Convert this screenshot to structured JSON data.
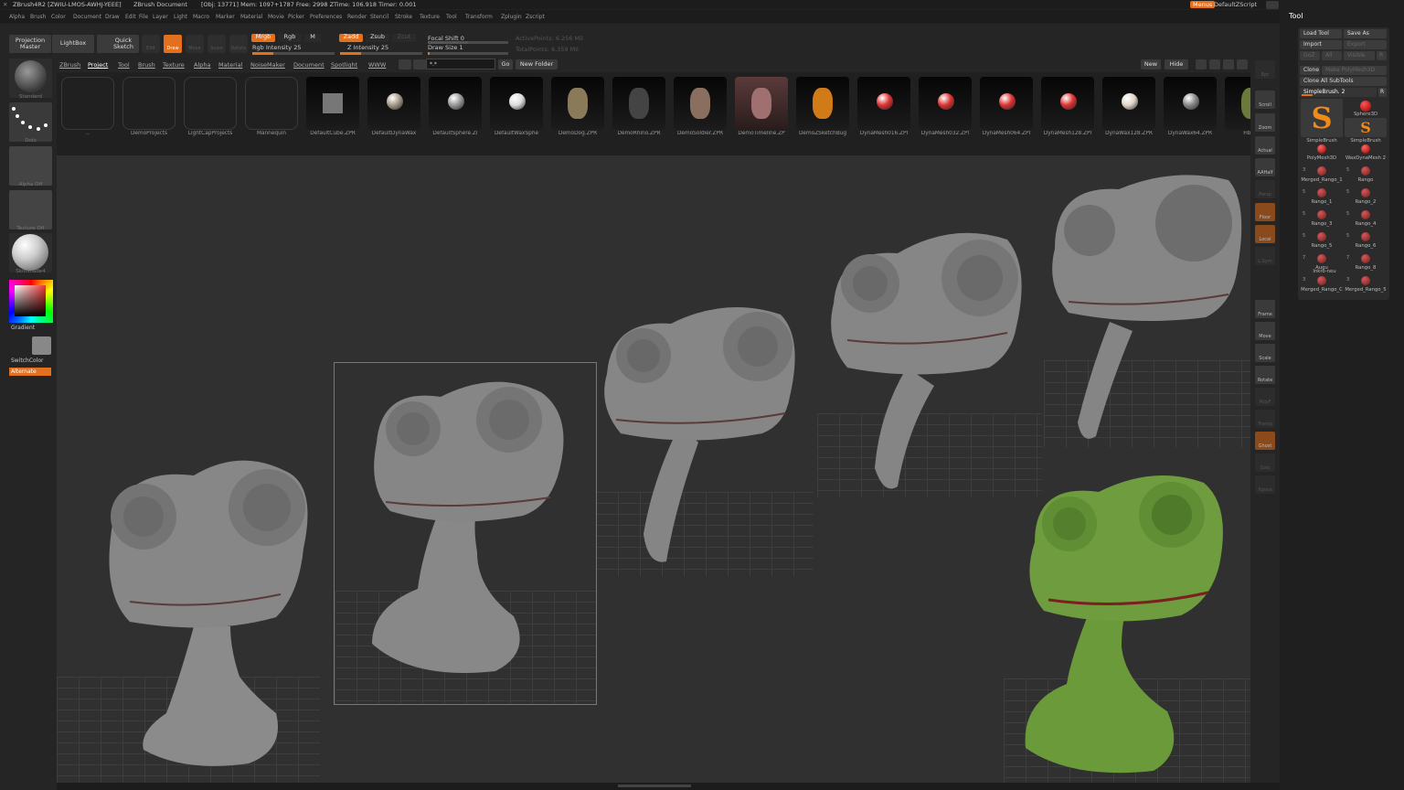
{
  "app": {
    "title": "ZBrush4R2 [ZWIU-LMOS-AWHJ-YEEE]",
    "document": "ZBrush Document",
    "stats": "[Obj: 13771] Mem: 1097+1787 Free: 2998 ZTime: 106.918 Timer: 0.001",
    "menus_btn": "Menus",
    "script_name": "DefaultZScript"
  },
  "menubar": [
    "Alpha",
    "Brush",
    "Color",
    "Document",
    "Draw",
    "Edit",
    "File",
    "Layer",
    "Light",
    "Macro",
    "Marker",
    "Material",
    "Movie",
    "Picker",
    "Preferences",
    "Render",
    "Stencil",
    "Stroke",
    "Texture",
    "Tool",
    "Transform",
    "Zplugin",
    "Zscript"
  ],
  "shelf": {
    "projection_master": "Projection Master",
    "lightbox": "LightBox",
    "quick_sketch": "Quick Sketch",
    "edit": "Edit",
    "draw": "Draw",
    "move": "Move",
    "scale": "Scale",
    "rotate": "Rotate",
    "mrgb": "Mrgb",
    "rgb": "Rgb",
    "m": "M",
    "zadd": "Zadd",
    "zsub": "Zsub",
    "zcut": "Zcut",
    "rgb_intensity": "Rgb Intensity 25",
    "z_intensity": "Z Intensity 25",
    "focal_shift": "Focal Shift 0",
    "draw_size": "Draw Size 1",
    "active_points": "ActivePoints: 6.256 Mil",
    "total_points": "TotalPoints: 6.359 Mil",
    "rgb_intensity_value": 25,
    "z_intensity_value": 25,
    "focal_shift_value": 0,
    "draw_size_value": 1
  },
  "lightbox": {
    "tabs": [
      "ZBrush",
      "Project",
      "Tool",
      "Brush",
      "Texture",
      "Alpha",
      "Material",
      "NoiseMaker",
      "Document",
      "Spotlight",
      "WWW"
    ],
    "active_tab": "Project",
    "path": "*.*",
    "go": "Go",
    "new_folder": "New Folder",
    "new": "New",
    "hide": "Hide",
    "items": [
      "..",
      "DemoProjects",
      "LightCapProjects",
      "Mannequin",
      "DefaultCube.ZPR",
      "DefaultDynaWax",
      "DefaultSphere.ZI",
      "DefaultWaxSphe",
      "DemoDog.ZPR",
      "DemoRhino.ZPR",
      "DemoSoldier.ZPR",
      "DemoTimeline.ZP",
      "DemoZSketchBug",
      "DynaMesh016.ZPI",
      "DynaMesh032.ZPI",
      "DynaMesh064.ZPI",
      "DynaMesh128.ZPI",
      "DynaWax128.ZPR",
      "DynaWax64.ZPR",
      "Fiberv"
    ]
  },
  "leftpanel": {
    "standard": "Standard",
    "dots": "Dots",
    "alpha_off": "Alpha Off",
    "texture_off": "Texture Off",
    "material": "SkinShade4",
    "gradient": "Gradient",
    "switch_color": "SwitchColor",
    "alternate": "Alternate"
  },
  "righttools": [
    "Bpr",
    "Scroll",
    "Zoom",
    "Actual",
    "AAHalf",
    "Persp",
    "Floor",
    "Local",
    "L.Sym",
    "Frame",
    "Move",
    "Scale",
    "Rotate",
    "PolyF",
    "Transp",
    "Ghost",
    "Solo",
    "Xpose"
  ],
  "tool": {
    "title": "Tool",
    "load_tool": "Load Tool",
    "save_as": "Save As",
    "import": "Import",
    "export": "Export",
    "goz": "GoZ",
    "all": "All",
    "visible": "Visible",
    "r": "R",
    "clone": "Clone",
    "make_polymesh": "Make PolyMesh3D",
    "clone_all": "Clone All SubTools",
    "current": "SimpleBrush. 2",
    "current_r": "R",
    "items": [
      {
        "name": "SimpleBrush",
        "num": ""
      },
      {
        "name": "Sphere3D",
        "num": ""
      },
      {
        "name": "",
        "num": ""
      },
      {
        "name": "SimpleBrush",
        "num": ""
      },
      {
        "name": "PolyMesh3D",
        "num": ""
      },
      {
        "name": "WaxDynaMesh 2",
        "num": ""
      },
      {
        "name": "Merged_Rango_1",
        "num": "3"
      },
      {
        "name": "Rango",
        "num": "5"
      },
      {
        "name": "Rango_1",
        "num": "5"
      },
      {
        "name": "Rango_2",
        "num": "5"
      },
      {
        "name": "Rango_3",
        "num": "5"
      },
      {
        "name": "Rango_4",
        "num": "5"
      },
      {
        "name": "Rango_5",
        "num": "5"
      },
      {
        "name": "Rango_6",
        "num": "5"
      },
      {
        "name": "Augu",
        "num": "7"
      },
      {
        "name": "Rango_8",
        "num": "7"
      },
      {
        "name": "Merged_Rango_C",
        "num": "3"
      },
      {
        "name": "Merged_Rango_5",
        "num": "3"
      }
    ],
    "inline_label": "Inkro-neu"
  },
  "colors": {
    "accent": "#e3701e",
    "panel": "#252525",
    "viewport": "#303030",
    "head_gray": "#8a8a8a",
    "head_green": "#6f9a3a"
  }
}
